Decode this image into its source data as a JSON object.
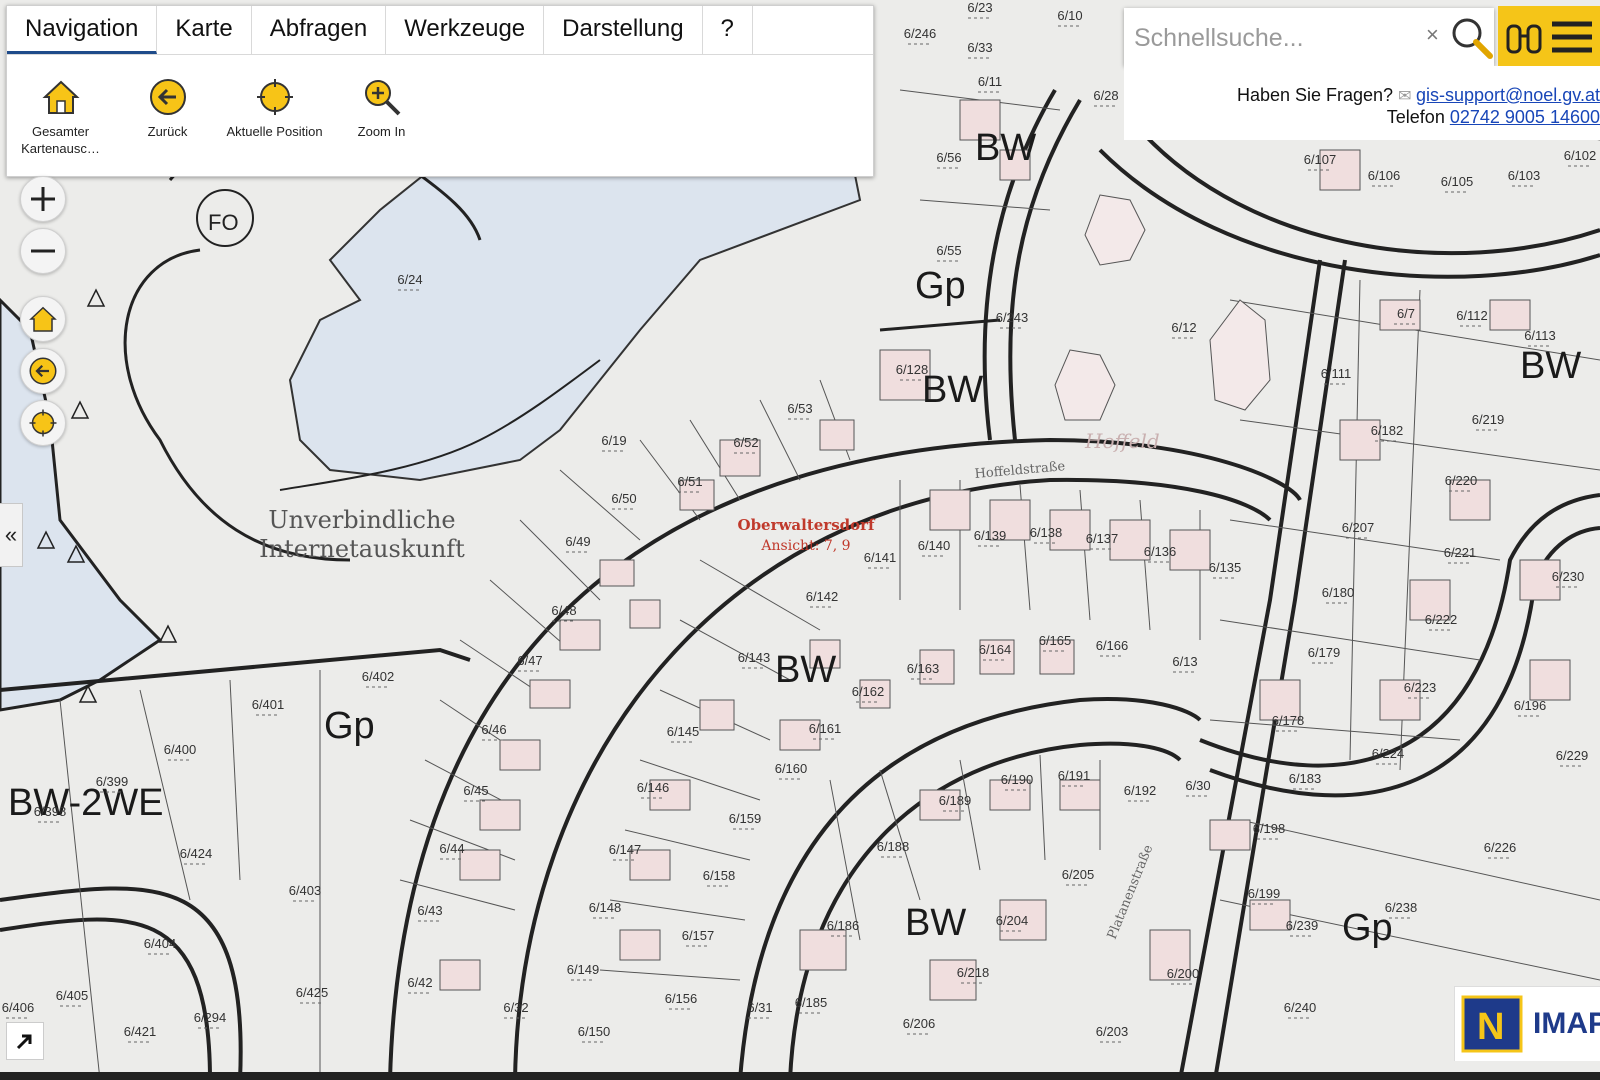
{
  "toolbar": {
    "tabs": [
      {
        "label": "Navigation",
        "active": true
      },
      {
        "label": "Karte"
      },
      {
        "label": "Abfragen"
      },
      {
        "label": "Werkzeuge"
      },
      {
        "label": "Darstellung"
      },
      {
        "label": "?"
      }
    ],
    "tools": [
      {
        "label": "Gesamter Kartenausc…",
        "icon": "home-icon"
      },
      {
        "label": "Zurück",
        "icon": "back-arrow-icon"
      },
      {
        "label": "Aktuelle Position",
        "icon": "crosshair-icon"
      },
      {
        "label": "Zoom In",
        "icon": "zoom-in-icon"
      }
    ]
  },
  "search": {
    "placeholder": "Schnellsuche...",
    "clear": "×"
  },
  "help": {
    "question": "Haben Sie Fragen?",
    "email": "gis-support@noel.gv.at",
    "phone_label": "Telefon",
    "phone": "02742 9005 14600"
  },
  "controls": {
    "collapse": "«"
  },
  "map": {
    "watermark_line1": "Unverbindliche",
    "watermark_line2": "Internetauskunft",
    "place_name": "Oberwaltersdorf",
    "view_label": "Ansicht: 7, 9",
    "street_labels": [
      "Hoffeldstraße",
      "Hoffeld",
      "Platanenstraße"
    ],
    "zones": [
      "BW",
      "BW",
      "BW",
      "BW",
      "BW",
      "BW-2WE",
      "Gp",
      "Gp",
      "Gp",
      "FO"
    ],
    "plots": [
      "6/24",
      "6/19",
      "6/50",
      "6/49",
      "6/48",
      "6/47",
      "6/46",
      "6/45",
      "6/44",
      "6/43",
      "6/42",
      "6/32",
      "6/51",
      "6/52",
      "6/53",
      "6/128",
      "6/55",
      "6/56",
      "6/243",
      "6/12",
      "6/111",
      "6/182",
      "6/219",
      "6/220",
      "6/207",
      "6/221",
      "6/180",
      "6/222",
      "6/179",
      "6/223",
      "6/178",
      "6/224",
      "6/183",
      "6/230",
      "6/196",
      "6/229",
      "6/226",
      "6/238",
      "6/239",
      "6/240",
      "6/198",
      "6/199",
      "6/200",
      "6/203",
      "6/205",
      "6/204",
      "6/218",
      "6/206",
      "6/185",
      "6/186",
      "6/188",
      "6/189",
      "6/190",
      "6/191",
      "6/192",
      "6/30",
      "6/31",
      "6/150",
      "6/156",
      "6/157",
      "6/158",
      "6/159",
      "6/160",
      "6/161",
      "6/162",
      "6/163",
      "6/164",
      "6/165",
      "6/166",
      "6/13",
      "6/135",
      "6/136",
      "6/137",
      "6/138",
      "6/139",
      "6/140",
      "6/141",
      "6/142",
      "6/143",
      "6/145",
      "6/146",
      "6/147",
      "6/148",
      "6/149",
      "6/402",
      "6/401",
      "6/400",
      "6/399",
      "6/398",
      "6/424",
      "6/403",
      "6/404",
      "6/405",
      "6/406",
      "6/421",
      "6/294",
      "6/425",
      "6/107",
      "6/106",
      "6/105",
      "6/103",
      "6/102",
      "6/7",
      "6/112",
      "6/113",
      "6/246",
      "6/23",
      "6/10",
      "6/33",
      "6/11",
      "6/28"
    ]
  },
  "logo": {
    "text": "IMAP"
  }
}
